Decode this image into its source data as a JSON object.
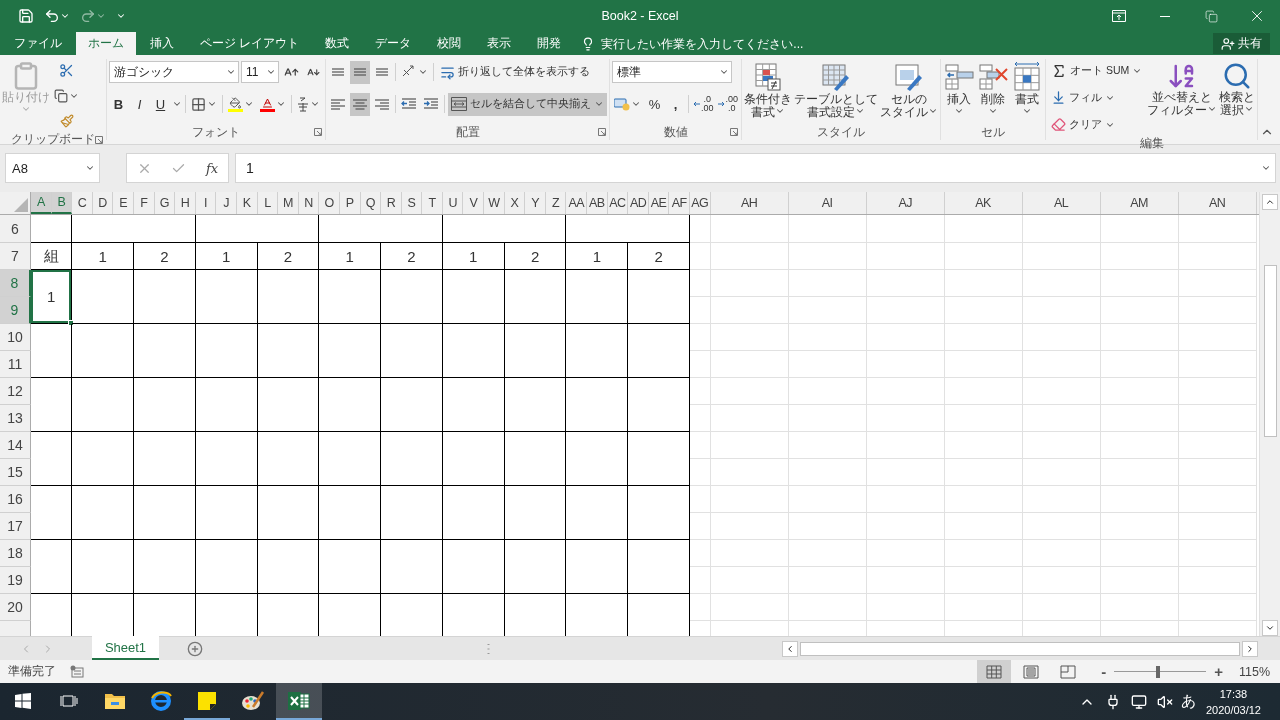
{
  "title_bar": {
    "title": "Book2 - Excel"
  },
  "ribbon_tabs": [
    {
      "label": "ファイル",
      "selected": false
    },
    {
      "label": "ホーム",
      "selected": true
    },
    {
      "label": "挿入",
      "selected": false
    },
    {
      "label": "ページ レイアウト",
      "selected": false
    },
    {
      "label": "数式",
      "selected": false
    },
    {
      "label": "データ",
      "selected": false
    },
    {
      "label": "校閲",
      "selected": false
    },
    {
      "label": "表示",
      "selected": false
    },
    {
      "label": "開発",
      "selected": false
    }
  ],
  "tell_me": {
    "placeholder": "実行したい作業を入力してください..."
  },
  "share_button": {
    "label": "共有"
  },
  "ribbon": {
    "clipboard": {
      "label": "クリップボード",
      "paste": {
        "label": "貼り付け",
        "disabled": true
      }
    },
    "font": {
      "label": "フォント",
      "font_name": "游ゴシック",
      "font_size": "11",
      "bold": "B",
      "italic": "I",
      "underline": "U"
    },
    "alignment": {
      "label": "配置",
      "wrap_text": "折り返して全体を表示する",
      "merge_center": {
        "label": "セルを結合して中央揃え",
        "active": true
      },
      "align_buttons": [
        {
          "kind": "top",
          "active": false
        },
        {
          "kind": "middle",
          "active": true
        },
        {
          "kind": "bottom",
          "active": false
        },
        {
          "kind": "left",
          "active": false
        },
        {
          "kind": "center",
          "active": true
        },
        {
          "kind": "right",
          "active": false
        }
      ]
    },
    "number": {
      "label": "数値",
      "format": "標準",
      "percent": "%",
      "comma": ",",
      "decimal_buttons": [
        {
          "kind": "increase",
          "lines": [
            ".0",
            ".00"
          ]
        },
        {
          "kind": "decrease",
          "lines": [
            ".00",
            ".0"
          ]
        }
      ]
    },
    "styles": {
      "label": "スタイル",
      "buttons": [
        {
          "kind": "conditional",
          "lines": [
            "条件付き",
            "書式"
          ]
        },
        {
          "kind": "table",
          "lines": [
            "テーブルとして",
            "書式設定"
          ]
        },
        {
          "kind": "cell_style",
          "lines": [
            "セルの",
            "スタイル"
          ]
        }
      ]
    },
    "cells": {
      "label": "セル",
      "buttons": [
        {
          "kind": "insert",
          "lines": [
            "挿入"
          ]
        },
        {
          "kind": "delete",
          "lines": [
            "削除"
          ]
        },
        {
          "kind": "format",
          "lines": [
            "書式"
          ]
        }
      ]
    },
    "editing": {
      "label": "編集",
      "small_buttons": [
        {
          "kind": "sum",
          "label": "オート SUM"
        },
        {
          "kind": "fill",
          "label": "フィル"
        },
        {
          "kind": "clear",
          "label": "クリア"
        }
      ],
      "buttons": [
        {
          "kind": "sort",
          "lines": [
            "並べ替えと",
            "フィルター"
          ]
        },
        {
          "kind": "find",
          "lines": [
            "検索と",
            "選択"
          ]
        }
      ]
    }
  },
  "formula_bar": {
    "name_box": "A8",
    "function_label": "fx",
    "value": "1"
  },
  "sheet": {
    "columns": [
      {
        "label": "A",
        "selected": true
      },
      {
        "label": "B",
        "selected": true
      },
      {
        "label": "C",
        "selected": false
      },
      {
        "label": "D",
        "selected": false
      },
      {
        "label": "E",
        "selected": false
      },
      {
        "label": "F",
        "selected": false
      },
      {
        "label": "G",
        "selected": false
      },
      {
        "label": "H",
        "selected": false
      },
      {
        "label": "I",
        "selected": false
      },
      {
        "label": "J",
        "selected": false
      },
      {
        "label": "K",
        "selected": false
      },
      {
        "label": "L",
        "selected": false
      },
      {
        "label": "M",
        "selected": false
      },
      {
        "label": "N",
        "selected": false
      },
      {
        "label": "O",
        "selected": false
      },
      {
        "label": "P",
        "selected": false
      },
      {
        "label": "Q",
        "selected": false
      },
      {
        "label": "R",
        "selected": false
      },
      {
        "label": "S",
        "selected": false
      },
      {
        "label": "T",
        "selected": false
      },
      {
        "label": "U",
        "selected": false
      },
      {
        "label": "V",
        "selected": false
      },
      {
        "label": "W",
        "selected": false
      },
      {
        "label": "X",
        "selected": false
      },
      {
        "label": "Y",
        "selected": false
      },
      {
        "label": "Z",
        "selected": false
      },
      {
        "label": "AA",
        "selected": false
      },
      {
        "label": "AB",
        "selected": false
      },
      {
        "label": "AC",
        "selected": false
      },
      {
        "label": "AD",
        "selected": false
      },
      {
        "label": "AE",
        "selected": false
      },
      {
        "label": "AF",
        "selected": false
      },
      {
        "label": "AG",
        "selected": false
      },
      {
        "label": "AH",
        "selected": false
      },
      {
        "label": "AI",
        "selected": false
      },
      {
        "label": "AJ",
        "selected": false
      },
      {
        "label": "AK",
        "selected": false
      },
      {
        "label": "AL",
        "selected": false
      },
      {
        "label": "AM",
        "selected": false
      },
      {
        "label": "AN",
        "selected": false
      }
    ],
    "row_6": {
      "header": {
        "label": "6",
        "selected": false
      }
    },
    "row_7": {
      "header": {
        "label": "7",
        "selected": false
      },
      "cells": [
        "組",
        "1",
        "2",
        "1",
        "2",
        "1",
        "2",
        "1",
        "2",
        "1",
        "2"
      ]
    },
    "row_pairs": [
      {
        "headers": [
          {
            "label": "8",
            "selected": true
          },
          {
            "label": "9",
            "selected": true
          }
        ],
        "cells": [
          {
            "text": "1",
            "selected": true
          }
        ]
      },
      {
        "headers": [
          {
            "label": "10",
            "selected": false
          },
          {
            "label": "11",
            "selected": false
          }
        ]
      },
      {
        "headers": [
          {
            "label": "12",
            "selected": false
          },
          {
            "label": "13",
            "selected": false
          }
        ]
      },
      {
        "headers": [
          {
            "label": "14",
            "selected": false
          },
          {
            "label": "15",
            "selected": false
          }
        ]
      },
      {
        "headers": [
          {
            "label": "16",
            "selected": false
          },
          {
            "label": "17",
            "selected": false
          }
        ]
      },
      {
        "headers": [
          {
            "label": "18",
            "selected": false
          },
          {
            "label": "19",
            "selected": false
          }
        ]
      },
      {
        "headers": [
          {
            "label": "20",
            "selected": false
          }
        ]
      }
    ]
  },
  "sheet_tabs": [
    {
      "label": "Sheet1",
      "selected": true
    }
  ],
  "status_bar": {
    "text": "準備完了",
    "views": [
      {
        "kind": "normal",
        "selected": true
      },
      {
        "kind": "page_layout",
        "selected": false
      },
      {
        "kind": "page_break",
        "selected": false
      }
    ],
    "zoom": {
      "zoom_out": "-",
      "zoom_in": "+",
      "level": 0.48,
      "text": "115%"
    }
  },
  "taskbar": {
    "apps": [
      {
        "kind": "explorer",
        "running": false,
        "selected": false
      },
      {
        "kind": "edge",
        "running": false,
        "selected": false
      },
      {
        "kind": "notes",
        "running": true,
        "selected": false
      },
      {
        "kind": "paint",
        "running": false,
        "selected": false
      },
      {
        "kind": "excel",
        "running": true,
        "selected": true
      }
    ],
    "ime": "あ",
    "time": "17:38",
    "date": "2020/03/12"
  }
}
